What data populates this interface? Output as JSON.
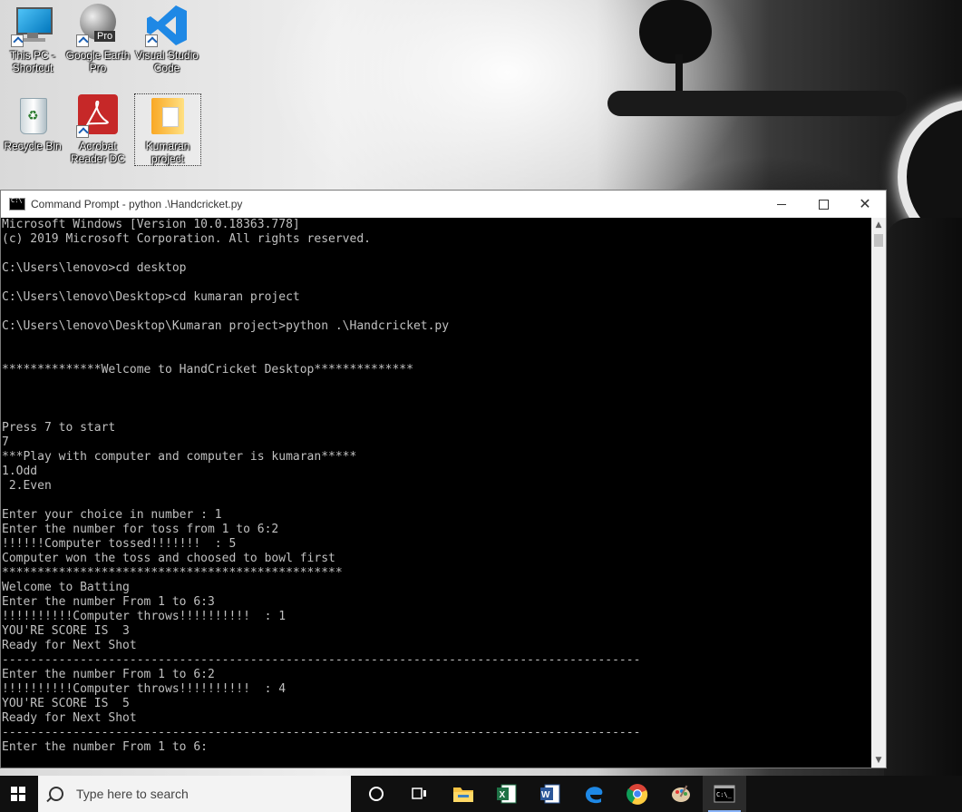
{
  "desktop": {
    "icons": [
      {
        "label": "This PC - Shortcut"
      },
      {
        "label": "Google Earth Pro"
      },
      {
        "label": "Visual Studio Code"
      },
      {
        "label": "Recycle Bin"
      },
      {
        "label": "Acrobat Reader DC"
      },
      {
        "label": "Kumaran project"
      }
    ],
    "earth_badge": "Pro"
  },
  "window": {
    "title": "Command Prompt - python  .\\Handcricket.py",
    "close_glyph": "✕"
  },
  "console": {
    "lines": [
      "Microsoft Windows [Version 10.0.18363.778]",
      "(c) 2019 Microsoft Corporation. All rights reserved.",
      "",
      "C:\\Users\\lenovo>cd desktop",
      "",
      "C:\\Users\\lenovo\\Desktop>cd kumaran project",
      "",
      "C:\\Users\\lenovo\\Desktop\\Kumaran project>python .\\Handcricket.py",
      "",
      "",
      "**************Welcome to HandCricket Desktop**************",
      "",
      "",
      "",
      "Press 7 to start",
      "7",
      "***Play with computer and computer is kumaran*****",
      "1.Odd",
      " 2.Even",
      "",
      "Enter your choice in number : 1",
      "Enter the number for toss from 1 to 6:2",
      "!!!!!!Computer tossed!!!!!!!  : 5",
      "Computer won the toss and choosed to bowl first",
      "************************************************",
      "Welcome to Batting",
      "Enter the number From 1 to 6:3",
      "!!!!!!!!!!Computer throws!!!!!!!!!!  : 1",
      "YOU'RE SCORE IS  3",
      "Ready for Next Shot",
      "------------------------------------------------------------------------------------------",
      "Enter the number From 1 to 6:2",
      "!!!!!!!!!!Computer throws!!!!!!!!!!  : 4",
      "YOU'RE SCORE IS  5",
      "Ready for Next Shot",
      "------------------------------------------------------------------------------------------",
      "Enter the number From 1 to 6:"
    ]
  },
  "taskbar": {
    "search_placeholder": "Type here to search",
    "apps": [
      "task-view",
      "file-explorer",
      "excel",
      "word",
      "edge",
      "chrome",
      "paint",
      "command-prompt"
    ]
  },
  "colors": {
    "console_bg": "#000000",
    "console_text": "#c0c0c0",
    "taskbar_bg": "#101010"
  }
}
